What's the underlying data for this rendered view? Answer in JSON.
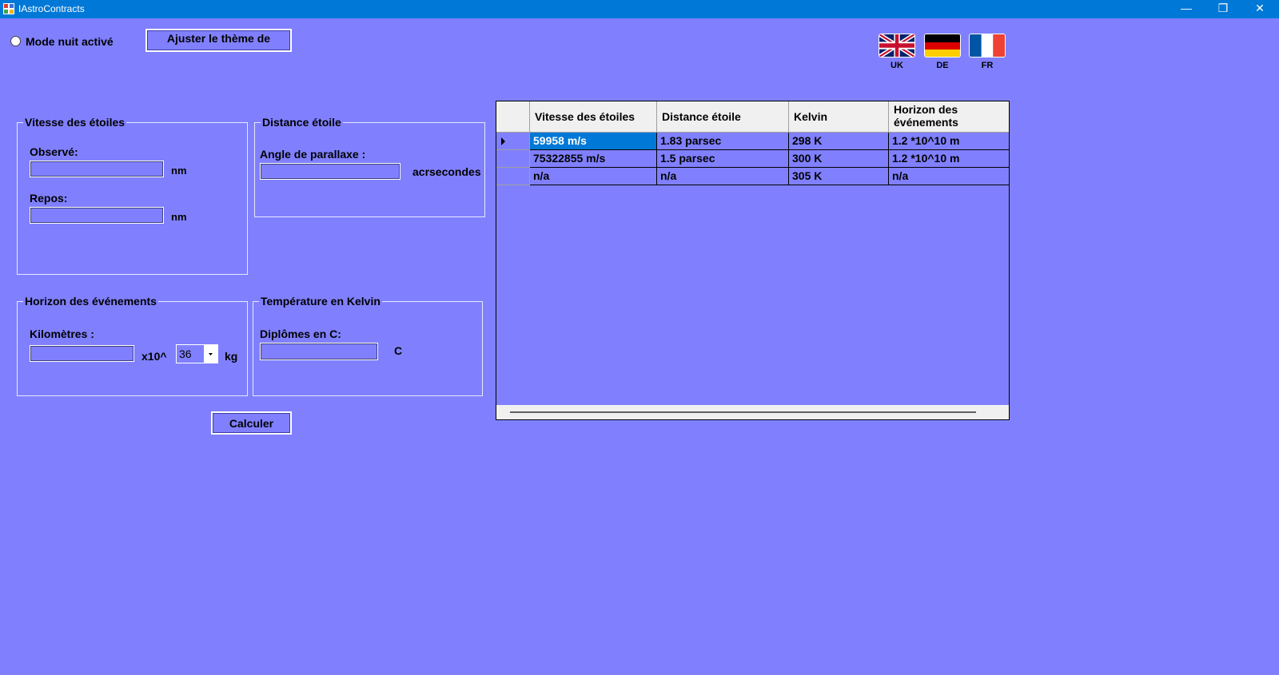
{
  "window": {
    "title": "IAstroContracts",
    "minimize": "—",
    "restore": "❐",
    "close": "✕"
  },
  "toolbar": {
    "night_mode_label": "Mode nuit activé",
    "theme_button": "Ajuster le thème de"
  },
  "languages": [
    {
      "code": "UK",
      "flag": "uk-flag-icon"
    },
    {
      "code": "DE",
      "flag": "germany-flag-icon"
    },
    {
      "code": "FR",
      "flag": "france-flag-icon"
    }
  ],
  "star_speed": {
    "title": "Vitesse des étoiles",
    "observed_label": "Observé:",
    "observed_value": "",
    "observed_unit": "nm",
    "rest_label": "Repos:",
    "rest_value": "",
    "rest_unit": "nm"
  },
  "star_distance": {
    "title": "Distance étoile",
    "parallax_label": "Angle de parallaxe :",
    "parallax_value": "",
    "parallax_unit": "acrsecondes"
  },
  "event_horizon": {
    "title": "Horizon des événements",
    "km_label": "Kilomètres :",
    "km_value": "",
    "exp_label": "x10^",
    "exp_value": "36",
    "unit": "kg"
  },
  "temperature": {
    "title": "Température en Kelvin",
    "celsius_label": "Diplômes en C:",
    "celsius_value": "",
    "unit": "C"
  },
  "calculate_button": "Calculer",
  "grid": {
    "columns": [
      "Vitesse des étoiles",
      "Distance étoile",
      "Kelvin",
      "Horizon des événements"
    ],
    "rows": [
      [
        "59958 m/s",
        "1.83 parsec",
        "298 K",
        "1.2 *10^10 m"
      ],
      [
        "75322855 m/s",
        "1.5 parsec",
        "300 K",
        "1.2 *10^10 m"
      ],
      [
        "n/a",
        "n/a",
        "305 K",
        "n/a"
      ]
    ],
    "selected_row": 0
  },
  "colors": {
    "background": "#8080ff",
    "titlebar": "#0078d7",
    "selection": "#0078d7"
  }
}
